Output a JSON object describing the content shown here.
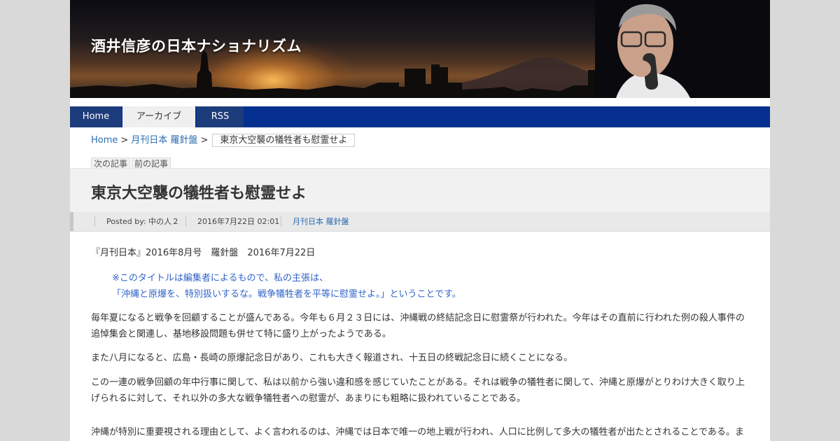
{
  "site": {
    "title": "酒井信彦の日本ナショナリズム"
  },
  "nav": {
    "items": [
      {
        "label": "Home"
      },
      {
        "label": "アーカイブ"
      },
      {
        "label": "RSS"
      }
    ]
  },
  "breadcrumb": {
    "home": "Home",
    "sep": ">",
    "category": "月刊日本 羅針盤",
    "current": "東京大空襲の犠牲者も慰霊せよ"
  },
  "pager": {
    "next": "次の記事",
    "prev": "前の記事"
  },
  "post": {
    "title": "東京大空襲の犠牲者も慰霊せよ",
    "author": "Posted by: 中の人２",
    "date": "2016年7月22日 02:01",
    "category": "月刊日本 羅針盤"
  },
  "content": {
    "p1": "『月刊日本』2016年8月号　羅針盤　2016年7月22日",
    "note1": "※このタイトルは編集者によるもので、私の主張は、",
    "note2": "「沖縄と原爆を、特別扱いするな。戦争犠牲者を平等に慰霊せよ。」ということです。",
    "p2": "毎年夏になると戦争を回顧することが盛んである。今年も６月２３日には、沖縄戦の終結記念日に慰霊祭が行われた。今年はその直前に行われた例の殺人事件の追悼集会と関連し、基地移設問題も併せて特に盛り上がったようである。",
    "p3": "また八月になると、広島・長崎の原爆記念日があり、これも大きく報道され、十五日の終戦記念日に続くことになる。",
    "p4": "この一連の戦争回顧の年中行事に関して、私は以前から強い違和感を感じていたことがある。それは戦争の犠牲者に関して、沖縄と原爆がとりわけ大きく取り上げられるに対して、それ以外の多大な戦争犠牲者への慰霊が、あまりにも粗略に扱われていることである。",
    "p5": "沖縄が特別に重要視される理由として、よく言われるのは、沖縄では日本で唯一の地上戦が行われ、人口に比例して多大の犠牲者が出たとされることである。ま"
  },
  "colors": {
    "nav_bg": "#05308f",
    "nav_tab": "#1d3c7c",
    "link": "#2b6cb0",
    "note": "#2f63c8"
  },
  "icons": {
    "header_image": "sunset-skyline-mount-fuji-with-speaker-photo"
  }
}
